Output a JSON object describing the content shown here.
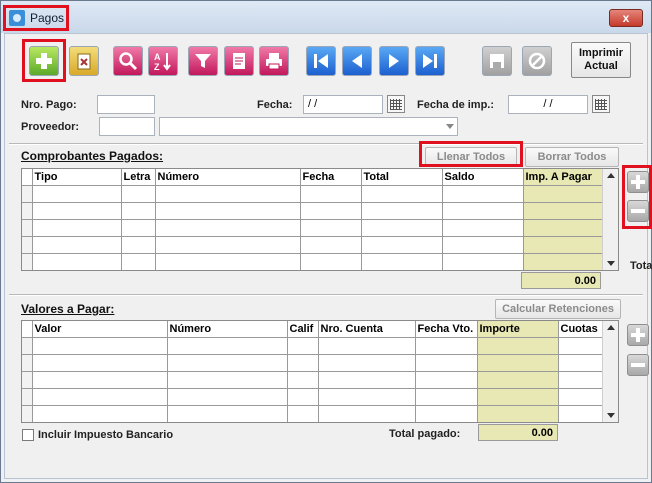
{
  "window": {
    "title": "Pagos",
    "close_label": "x"
  },
  "toolbar": {
    "print_current_label": "Imprimir\nActual",
    "buttons": [
      "add-icon",
      "delete-icon",
      "search-icon",
      "sort-az-icon",
      "filter-icon",
      "report-icon",
      "print-icon",
      "first-record-icon",
      "previous-record-icon",
      "next-record-icon",
      "last-record-icon",
      "save-icon",
      "cancel-icon"
    ]
  },
  "form": {
    "nro_pago_label": "Nro. Pago:",
    "fecha_label": "Fecha:",
    "fecha_value": " / /",
    "fecha_imp_label": "Fecha de imp.:",
    "fecha_imp_value": "/ /",
    "proveedor_label": "Proveedor:"
  },
  "comprobantes": {
    "title": "Comprobantes Pagados:",
    "llenar_label": "Llenar Todos",
    "borrar_label": "Borrar Todos",
    "columns": [
      "Tipo",
      "Letra",
      "Número",
      "Fecha",
      "Total",
      "Saldo",
      "Imp. A Pagar"
    ],
    "total_value": "0.00",
    "side_label": "Tota"
  },
  "valores": {
    "title": "Valores a Pagar:",
    "calcular_label": "Calcular Retenciones",
    "columns": [
      "Valor",
      "Número",
      "Calif",
      "Nro. Cuenta",
      "Fecha Vto.",
      "Importe",
      "Cuotas"
    ],
    "checkbox_label": "Incluir Impuesto Bancario",
    "total_label": "Total pagado:",
    "total_value": "0.00"
  }
}
